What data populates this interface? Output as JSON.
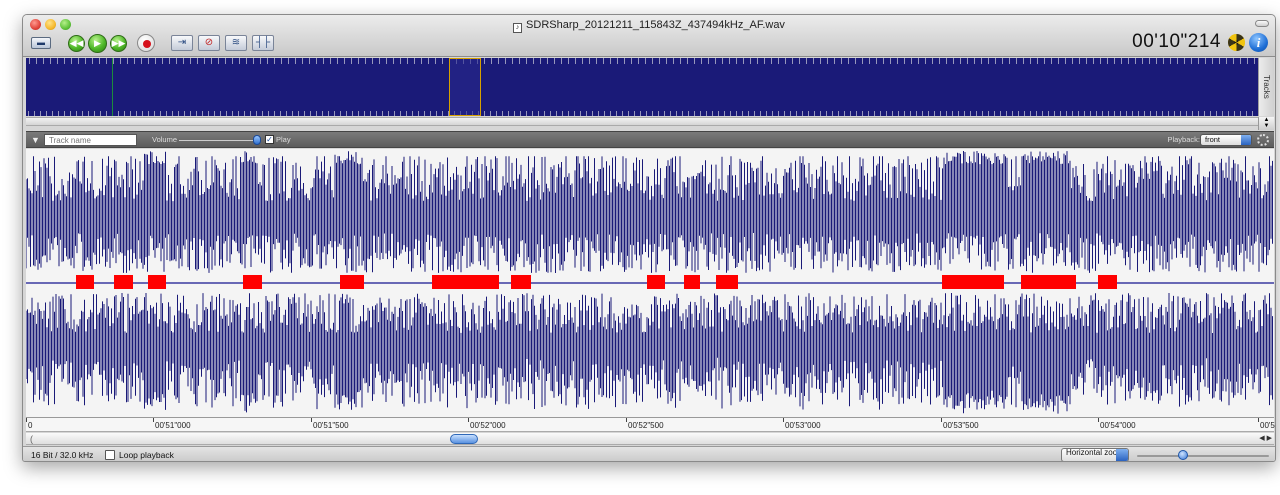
{
  "window": {
    "title": "SDRSharp_20121211_115843Z_437494kHz_AF.wav",
    "timecode": "00'10\"214"
  },
  "icons": {
    "toolbar": [
      "keyboard-icon",
      "rewind-icon",
      "play-icon",
      "fast-forward-icon",
      "record-icon",
      "insert-icon",
      "delete-icon",
      "effects-icon",
      "split-icon"
    ],
    "right": [
      "radioactive-icon",
      "info-icon"
    ]
  },
  "colors": {
    "waveform": "#1a1a78",
    "markers": "#ff0000",
    "selection": "#d6a000",
    "accent": "#2f6fd0"
  },
  "side_tab": "Tracks",
  "track": {
    "name_placeholder": "Track name",
    "volume_label": "Volume",
    "play_label": "Play",
    "play_checked": true,
    "playback_label": "Playback:",
    "playback_value": "front"
  },
  "ruler": {
    "ticks": [
      {
        "label": "0"
      },
      {
        "label": "00'51\"000"
      },
      {
        "label": "00'51\"500"
      },
      {
        "label": "00'52\"000"
      },
      {
        "label": "00'52\"500"
      },
      {
        "label": "00'53\"000"
      },
      {
        "label": "00'53\"500"
      },
      {
        "label": "00'54\"000"
      },
      {
        "label": "00'5"
      }
    ]
  },
  "status": {
    "format": "16 Bit / 32.0 kHz",
    "loop_label": "Loop playback",
    "loop_checked": false,
    "zoom_label": "Horizontal zoom"
  }
}
